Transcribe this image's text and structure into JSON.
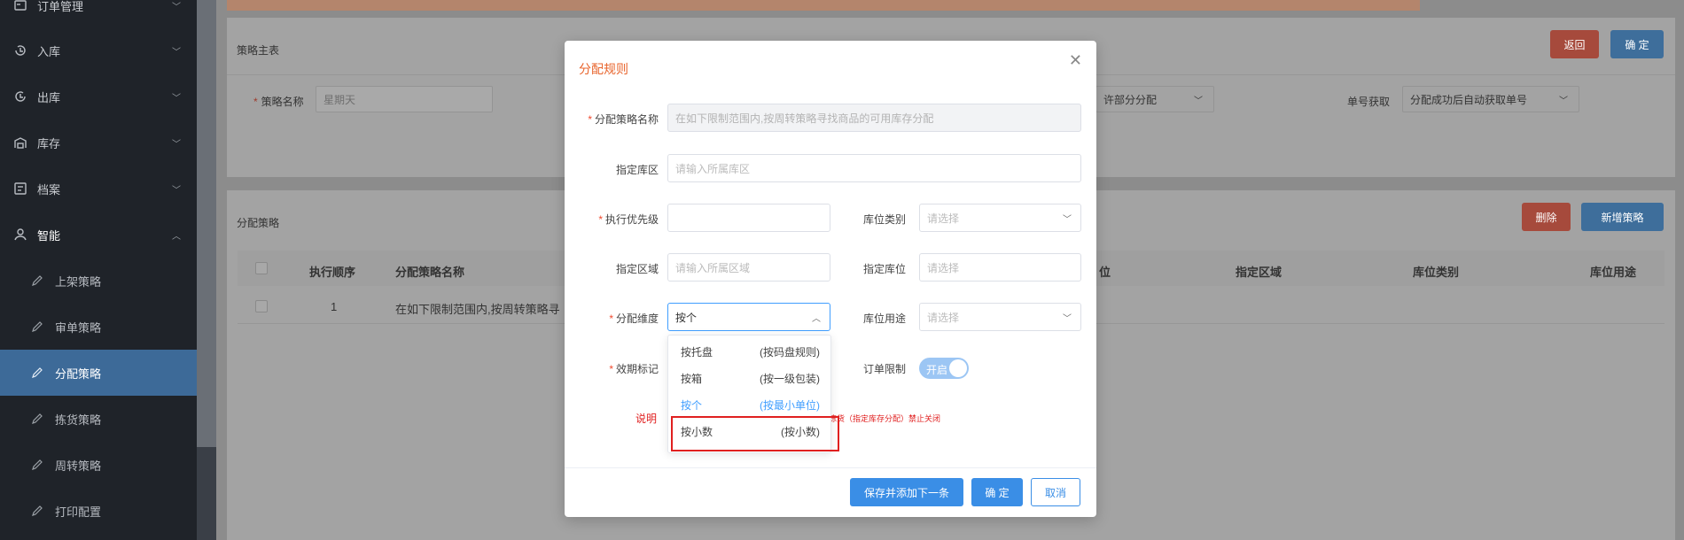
{
  "sidebar": {
    "menu": [
      {
        "label": "订单管理",
        "icon": "order-icon"
      },
      {
        "label": "入库",
        "icon": "inbound-icon"
      },
      {
        "label": "出库",
        "icon": "outbound-icon"
      },
      {
        "label": "库存",
        "icon": "inventory-icon"
      },
      {
        "label": "档案",
        "icon": "archive-icon"
      },
      {
        "label": "智能",
        "icon": "smart-icon"
      }
    ],
    "submenu": [
      {
        "label": "上架策略",
        "icon": "strategy-icon"
      },
      {
        "label": "审单策略",
        "icon": "strategy-icon"
      },
      {
        "label": "分配策略",
        "icon": "strategy-icon"
      },
      {
        "label": "拣货策略",
        "icon": "strategy-icon"
      },
      {
        "label": "周转策略",
        "icon": "strategy-icon"
      },
      {
        "label": "打印配置",
        "icon": "strategy-icon"
      }
    ]
  },
  "main": {
    "header_section": {
      "title": "策略主表",
      "back_label": "返回",
      "confirm_label": "确 定",
      "name_label": "策略名称",
      "name_value": "星期天",
      "partial_select": "许部分分配",
      "order_no_label": "单号获取",
      "order_no_value": "分配成功后自动获取单号"
    },
    "alloc_section": {
      "title": "分配策略",
      "delete_label": "删除",
      "add_label": "新增策略",
      "columns": [
        "执行顺序",
        "分配策略名称",
        "位",
        "指定区域",
        "库位类别",
        "库位用途"
      ],
      "rows": [
        {
          "order": "1",
          "name": "在如下限制范围内,按周转策略寻"
        }
      ]
    }
  },
  "dialog": {
    "title": "分配规则",
    "fields": {
      "rule_name_label": "分配策略名称",
      "rule_name_value": "在如下限制范围内,按周转策略寻找商品的可用库存分配",
      "zone_label": "指定库区",
      "zone_placeholder": "请输入所属库区",
      "priority_label": "执行优先级",
      "loc_type_label": "库位类别",
      "loc_type_placeholder": "请选择",
      "area_label": "指定区域",
      "area_placeholder": "请输入所属区域",
      "location_label": "指定库位",
      "location_placeholder": "请选择",
      "dimension_label": "分配维度",
      "dimension_value": "按个",
      "loc_use_label": "库位用途",
      "loc_use_placeholder": "请选择",
      "expiry_label": "效期标记",
      "order_limit_label": "订单限制",
      "order_limit_toggle": "开启",
      "explain_label": "说明",
      "explain_text": "拣货（指定库存分配）禁止关闭"
    },
    "footer": {
      "save_next_label": "保存并添加下一条",
      "ok_label": "确 定",
      "cancel_label": "取消"
    },
    "dropdown": [
      {
        "name": "按托盘",
        "desc": "(按码盘规则)",
        "selected": false
      },
      {
        "name": "按箱",
        "desc": "(按一级包装)",
        "selected": false
      },
      {
        "name": "按个",
        "desc": "(按最小单位)",
        "selected": true
      },
      {
        "name": "按小数",
        "desc": "(按小数)",
        "selected": false
      }
    ]
  }
}
